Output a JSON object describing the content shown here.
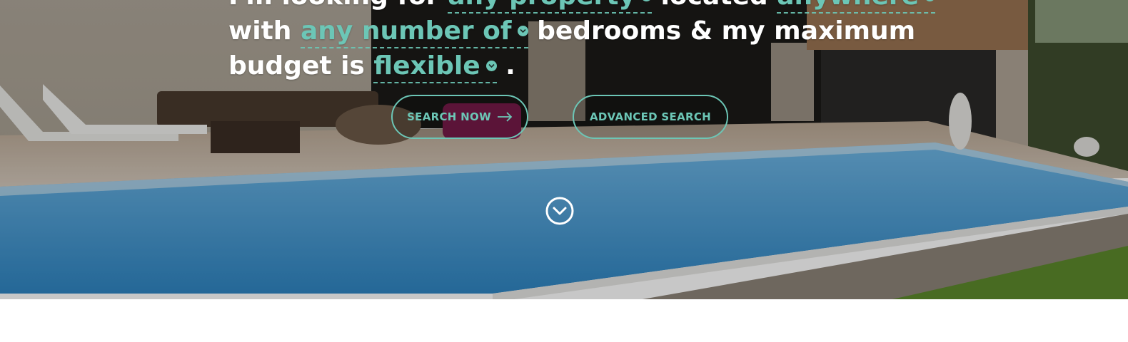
{
  "headline": {
    "line1_prefix": "I'm looking for",
    "property_type": "any property",
    "line1_middle": "located",
    "location": "anywhere",
    "line2_prefix": "with",
    "bedrooms": "any number of",
    "line2_suffix": "bedrooms & my maximum",
    "line3_prefix": "budget is",
    "budget": "flexible",
    "line3_suffix": "."
  },
  "buttons": {
    "search_now": "SEARCH NOW",
    "advanced_search": "ADVANCED SEARCH"
  },
  "icons": {
    "caret": "chevron-down-icon",
    "arrow": "arrow-right-icon",
    "scroll_down": "circle-chevron-down-icon"
  },
  "colors": {
    "accent": "#6cc6b6",
    "text": "#ffffff"
  }
}
